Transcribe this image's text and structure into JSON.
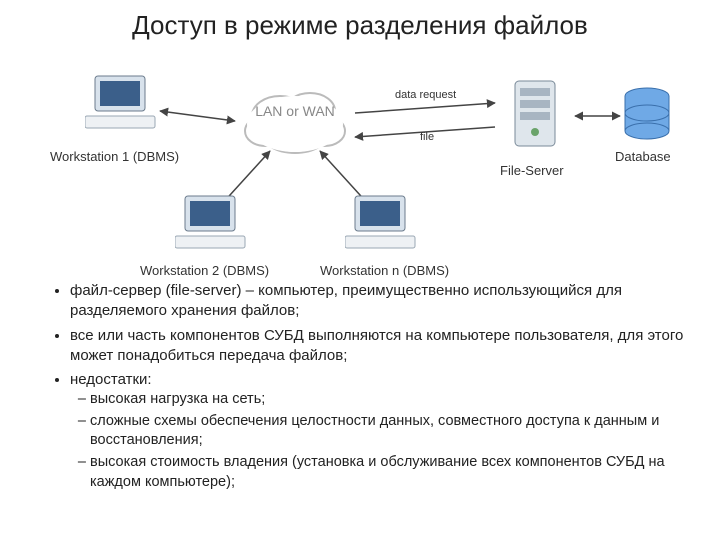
{
  "title": "Доступ в режиме разделения файлов",
  "diagram": {
    "cloud": "LAN or WAN",
    "ws1": "Workstation 1 (DBMS)",
    "ws2": "Workstation 2 (DBMS)",
    "wsn": "Workstation n (DBMS)",
    "fileserver": "File-Server",
    "database": "Database",
    "link_request": "data request",
    "link_file": "file"
  },
  "bullets": {
    "b1": "файл-сервер (file-server) – компьютер, преимущественно использующийся для разделяемого хранения файлов;",
    "b2": "все или часть компонентов СУБД выполняются на компьютере пользователя, для этого может понадобиться передача файлов;",
    "b3": "недостатки:",
    "s1": "высокая нагрузка на сеть;",
    "s2": "сложные схемы обеспечения целостности данных, совместного доступа к данным и восстановления;",
    "s3": "высокая стоимость владения (установка и обслуживание всех компонентов СУБД на каждом компьютере);"
  }
}
